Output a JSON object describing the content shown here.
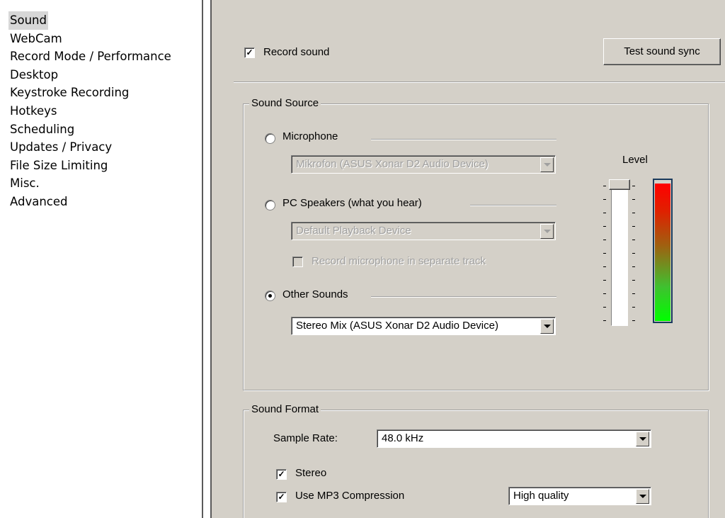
{
  "sidebar": {
    "items": [
      {
        "label": "Sound",
        "selected": true
      },
      {
        "label": "WebCam"
      },
      {
        "label": "Record Mode / Performance"
      },
      {
        "label": "Desktop"
      },
      {
        "label": "Keystroke Recording"
      },
      {
        "label": "Hotkeys"
      },
      {
        "label": "Scheduling"
      },
      {
        "label": "Updates / Privacy"
      },
      {
        "label": "File Size Limiting"
      },
      {
        "label": "Misc."
      },
      {
        "label": "Advanced"
      }
    ]
  },
  "sound": {
    "record_sound": {
      "label": "Record sound",
      "checked": true
    },
    "test_button": "Test sound sync",
    "source": {
      "title": "Sound Source",
      "microphone": {
        "label": "Microphone",
        "selected": false,
        "device": "Mikrofon (ASUS Xonar D2 Audio Device)"
      },
      "pc_speakers": {
        "label": "PC Speakers (what you hear)",
        "selected": false,
        "device": "Default Playback Device",
        "separate_track_label": "Record microphone in separate track"
      },
      "other": {
        "label": "Other Sounds",
        "selected": true,
        "device": "Stereo Mix (ASUS Xonar D2 Audio Device)"
      },
      "level_label": "Level",
      "slider_level": 1.0
    },
    "format": {
      "title": "Sound Format",
      "sample_rate_label": "Sample Rate:",
      "sample_rate": "48.0 kHz",
      "stereo": {
        "label": "Stereo",
        "checked": true
      },
      "mp3": {
        "label": "Use MP3 Compression",
        "checked": true
      },
      "quality": "High quality"
    }
  },
  "colors": {
    "panel_bg": "#d4d0c8",
    "selected_item_bg": "#d7d7d7",
    "meter_top": "#ff0000",
    "meter_bottom": "#00ff00"
  }
}
